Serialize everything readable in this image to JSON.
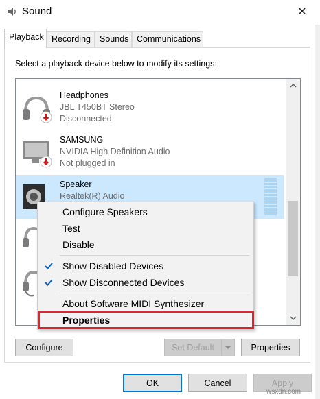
{
  "window": {
    "title": "Sound",
    "close_glyph": "✕"
  },
  "tabs": [
    {
      "label": "Playback",
      "active": true
    },
    {
      "label": "Recording",
      "active": false
    },
    {
      "label": "Sounds",
      "active": false
    },
    {
      "label": "Communications",
      "active": false
    }
  ],
  "instruction": "Select a playback device below to modify its settings:",
  "devices": [
    {
      "name": "Headphones",
      "line1": "JBL T450BT Stereo",
      "line2": "Disconnected",
      "icon": "headphones-icon",
      "status": "down-arrow-badge"
    },
    {
      "name": "SAMSUNG",
      "line1": "NVIDIA High Definition Audio",
      "line2": "Not plugged in",
      "icon": "monitor-icon",
      "status": "down-arrow-badge"
    },
    {
      "name": "Speaker",
      "line1": "Realtek(R) Audio",
      "line2": "",
      "icon": "speaker-icon",
      "status": "default-check-badge",
      "selected": true
    }
  ],
  "context_menu": {
    "items": [
      {
        "label": "Configure Speakers",
        "checked": false
      },
      {
        "label": "Test",
        "checked": false
      },
      {
        "label": "Disable",
        "checked": false
      },
      {
        "label": "Show Disabled Devices",
        "checked": true
      },
      {
        "label": "Show Disconnected Devices",
        "checked": true
      },
      {
        "label": "About Software MIDI Synthesizer",
        "checked": false
      },
      {
        "label": "Properties",
        "checked": false,
        "bold": true,
        "highlighted": true
      }
    ]
  },
  "buttons": {
    "configure": "Configure",
    "set_default": "Set Default",
    "properties": "Properties",
    "ok": "OK",
    "cancel": "Cancel",
    "apply": "Apply"
  },
  "watermark": "wsxdn.com",
  "colors": {
    "selection": "#cce8ff",
    "highlight_box": "#e0232e",
    "check": "#0a64c8",
    "default_button_border": "#0078d7"
  }
}
